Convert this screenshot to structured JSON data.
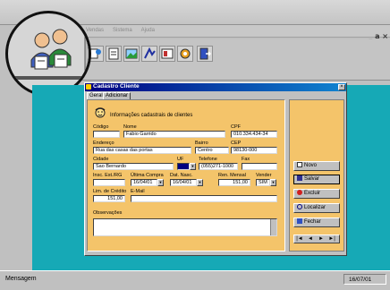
{
  "app": {
    "menu": [
      "Vendas",
      "Sistema",
      "Ajuda"
    ],
    "window_controls": "_ a ×",
    "toolbar_icons": [
      "sales-icon",
      "document-icon",
      "image-icon",
      "chart-icon",
      "report-icon",
      "settings-icon",
      "exit-icon"
    ]
  },
  "dialog": {
    "title": "Cadastro Cliente",
    "close_label": "×",
    "tabs": [
      "Geral",
      "Adicionar"
    ],
    "header_title": "Informações cadastrais de clientes",
    "fields": {
      "codigo": {
        "label": "Código",
        "value": ""
      },
      "nome": {
        "label": "Nome",
        "value": "Fabio Garrido"
      },
      "cpf": {
        "label": "CPF",
        "value": "010.334.434-34"
      },
      "endereco": {
        "label": "Endereço",
        "value": "Rua das casas das portas"
      },
      "bairro": {
        "label": "Bairro",
        "value": "Centro"
      },
      "cep": {
        "label": "CEP",
        "value": "98130-000"
      },
      "cidade": {
        "label": "Cidade",
        "value": "Sao Bernardo"
      },
      "uf": {
        "label": "UF",
        "value": ""
      },
      "telefone": {
        "label": "Telefone",
        "value": "(055)271-1000"
      },
      "fax": {
        "label": "Fax",
        "value": ""
      },
      "insc": {
        "label": "Insc. Est./RG",
        "value": ""
      },
      "ultima_compra": {
        "label": "Última Compra",
        "value": "16/04/01"
      },
      "dat_nasc": {
        "label": "Dat. Nasc.",
        "value": "16/04/01"
      },
      "ren_mensal": {
        "label": "Ren. Mensal",
        "value": "151,00"
      },
      "vender": {
        "label": "Vender",
        "value": "SIM"
      },
      "lim_credito": {
        "label": "Lim. de Crédito",
        "value": "151,00"
      },
      "email": {
        "label": "E-Mail",
        "value": ""
      },
      "observacoes": {
        "label": "Observações",
        "value": ""
      }
    },
    "buttons": {
      "novo": "Novo",
      "salvar": "Salvar",
      "excluir": "Excluir",
      "localizar": "Localizar",
      "fechar": "Fechar"
    },
    "nav": [
      "|◄",
      "◄",
      "►",
      "►|"
    ]
  },
  "status": {
    "message": "Mensagem",
    "date": "16/07/01"
  },
  "colors": {
    "desktop": "#16a9b6",
    "form_panel": "#f4c46a",
    "title_bar": "#000080"
  }
}
